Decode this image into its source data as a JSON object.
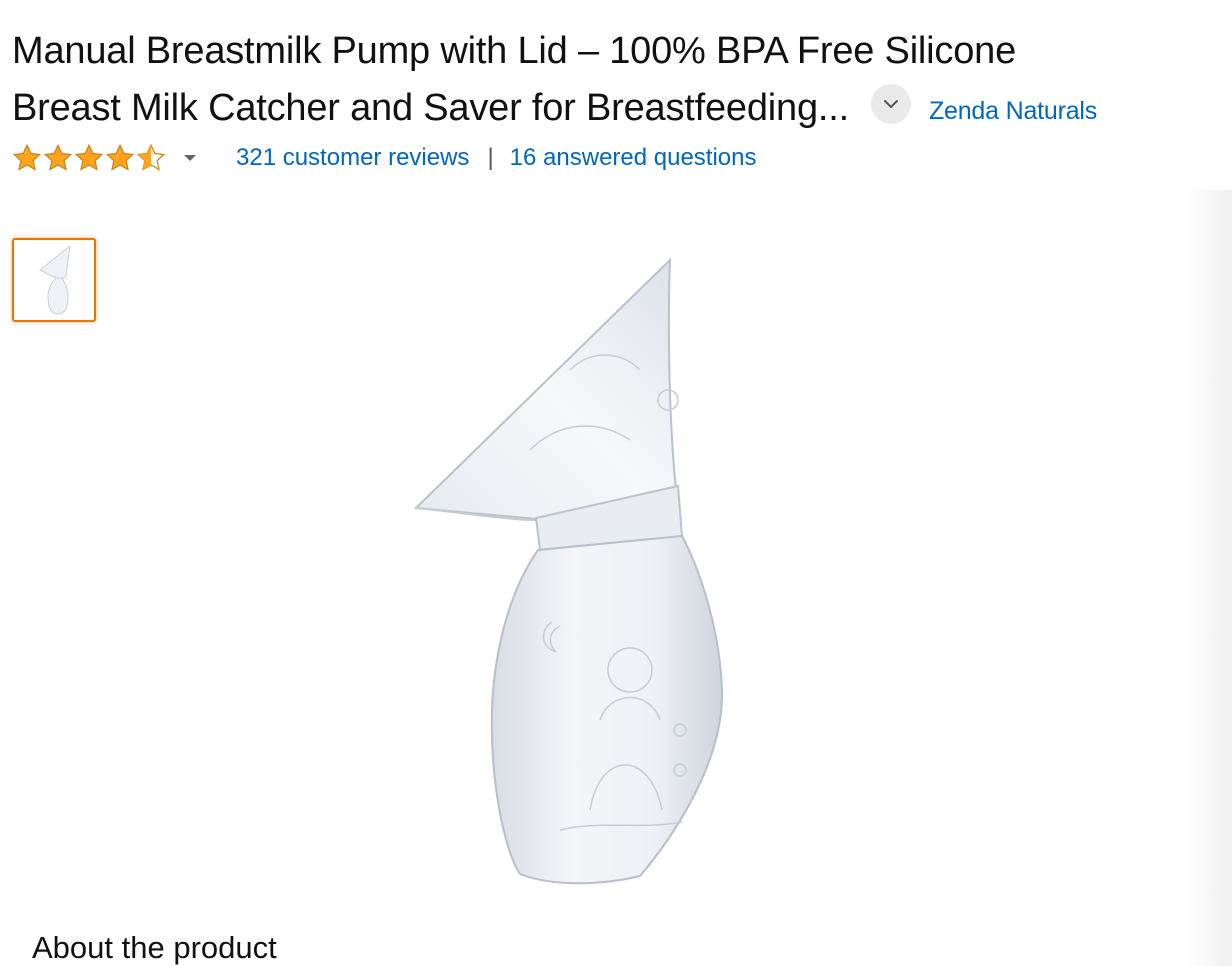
{
  "product": {
    "title_line1": "Manual Breastmilk Pump with Lid – 100% BPA Free Silicone",
    "title_line2": "Breast Milk Catcher and Saver for Breastfeeding...",
    "expand_icon": "chevron-down-icon",
    "brand": "Zenda Naturals"
  },
  "rating": {
    "stars": 4.5,
    "star_color": "#FFA41C",
    "reviews_link": "321 customer reviews",
    "separator": "|",
    "questions_link": "16 answered questions"
  },
  "gallery": {
    "selected_index": 0,
    "thumbnail_count": 1,
    "selected_border_color": "#E77600"
  },
  "sections": {
    "about_heading": "About the product"
  },
  "colors": {
    "link": "#0066C0",
    "text": "#111111"
  }
}
